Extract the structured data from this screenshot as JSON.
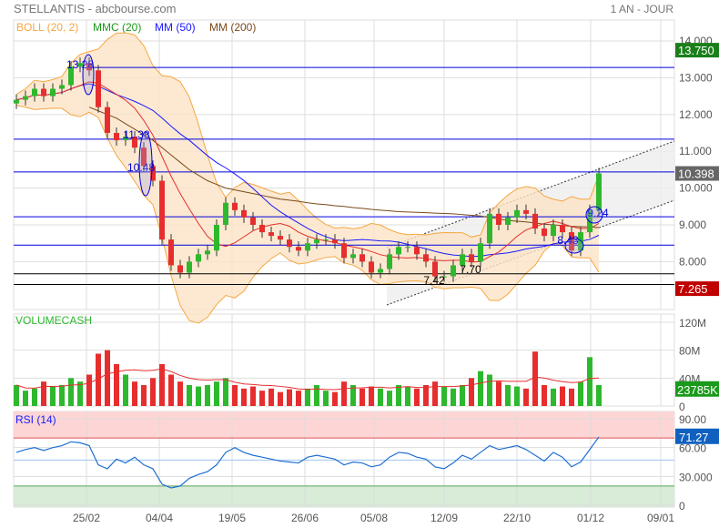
{
  "header": {
    "title": "STELLANTIS - abcbourse.com",
    "period": "1 AN - JOUR"
  },
  "legend": [
    {
      "label": "BOLL (20, 2)",
      "color": "#f5a742"
    },
    {
      "label": "MMC (20)",
      "color": "#1a9a1a"
    },
    {
      "label": "MM (50)",
      "color": "#1a1aff"
    },
    {
      "label": "MM (200)",
      "color": "#7a4a1a"
    }
  ],
  "colors": {
    "up": "#2eb82e",
    "down": "#e62e2e",
    "boll_fill": "#fde3c6",
    "boll_line": "#f5a742",
    "mmc": "#1a9a1a",
    "mm50": "#1a1aff",
    "mm200": "#7a4a1a",
    "level": "#0000dd",
    "rsi": "#1f6fd1"
  },
  "chart_data": [
    {
      "type": "candlestick",
      "title": "STELLANTIS",
      "ylim": [
        7,
        14.4
      ],
      "yticks": [
        "14.000",
        "13.000",
        "12.000",
        "11.000",
        "10.000",
        "9.000",
        "8.000"
      ],
      "ytick_values": [
        14,
        13,
        12,
        11,
        10,
        9,
        8
      ],
      "xticks": [
        "25/02",
        "04/04",
        "19/05",
        "26/06",
        "05/08",
        "12/09",
        "22/10",
        "01/12",
        "09/01"
      ],
      "close": [
        12.4,
        12.5,
        12.7,
        12.5,
        12.7,
        12.8,
        13.3,
        13.4,
        13.2,
        12.2,
        11.5,
        11.3,
        11.4,
        11.1,
        10.6,
        10.2,
        8.6,
        7.9,
        7.7,
        8.0,
        8.2,
        8.3,
        9.0,
        9.6,
        9.4,
        9.2,
        9.0,
        8.8,
        8.7,
        8.6,
        8.4,
        8.3,
        8.5,
        8.6,
        8.6,
        8.5,
        8.1,
        8.2,
        8.0,
        7.7,
        7.8,
        8.2,
        8.4,
        8.4,
        8.2,
        8.0,
        7.6,
        7.6,
        7.9,
        8.2,
        8.0,
        8.5,
        9.3,
        9.0,
        9.2,
        9.4,
        9.3,
        8.9,
        8.7,
        9.0,
        8.8,
        8.3,
        8.8,
        9.4,
        10.4
      ],
      "mm200": [
        null,
        null,
        null,
        null,
        null,
        null,
        null,
        null,
        12.2,
        12.1,
        12.0,
        11.9,
        11.75,
        11.6,
        11.45,
        11.3,
        11.1,
        10.9,
        10.7,
        10.5,
        10.35,
        10.2,
        10.1,
        10.0,
        9.95,
        9.9,
        9.85,
        9.8,
        9.75,
        9.7,
        9.67,
        9.64,
        9.6,
        9.57,
        9.55,
        9.52,
        9.5,
        9.47,
        9.45,
        9.42,
        9.4,
        9.38,
        9.36,
        9.35,
        9.34,
        9.33,
        9.32,
        9.31,
        9.3,
        9.28,
        9.26,
        9.24,
        9.2,
        9.16,
        9.12,
        9.1,
        9.08,
        9.05,
        9.02,
        9.0,
        8.98,
        8.96,
        8.95,
        8.94,
        8.93
      ],
      "levels": [
        {
          "value": 13.28,
          "label": "13.28"
        },
        {
          "value": 11.33,
          "label": "11.38"
        },
        {
          "value": 10.44,
          "label": "10.48"
        },
        {
          "value": 9.22,
          "label": "9.24"
        },
        {
          "value": 8.45,
          "label": "8.43"
        },
        {
          "value": 7.67,
          "label": "7.70",
          "black": true
        },
        {
          "value": 7.38,
          "label": "7.42",
          "black": true
        }
      ],
      "badges": [
        {
          "value": 13.75,
          "label": "13.750",
          "color": "#1a7f1a"
        },
        {
          "value": 10.398,
          "label": "10.398",
          "color": "#666666"
        },
        {
          "value": 7.265,
          "label": "7.265",
          "color": "#c00000"
        }
      ]
    },
    {
      "type": "bar",
      "title": "VOLUMECASH",
      "ylim": [
        0,
        120
      ],
      "yticks": [
        "120M",
        "80M",
        "40M",
        "0"
      ],
      "ytick_values": [
        120,
        80,
        40,
        0
      ],
      "values": [
        30,
        22,
        25,
        35,
        28,
        30,
        40,
        35,
        45,
        75,
        80,
        60,
        45,
        35,
        30,
        40,
        60,
        45,
        35,
        30,
        28,
        30,
        35,
        40,
        30,
        25,
        28,
        22,
        25,
        20,
        24,
        22,
        25,
        30,
        22,
        20,
        35,
        30,
        25,
        28,
        25,
        22,
        30,
        28,
        25,
        30,
        35,
        28,
        25,
        30,
        40,
        50,
        45,
        35,
        30,
        28,
        25,
        78,
        30,
        25,
        28,
        25,
        35,
        70,
        30
      ],
      "current": {
        "label": "23785K",
        "value": 23.8
      }
    },
    {
      "type": "line",
      "title": "RSI (14)",
      "ylim": [
        0,
        90
      ],
      "yticks": [
        "90.00",
        "60.00",
        "30.000",
        "0"
      ],
      "ytick_values": [
        90,
        60,
        30,
        0
      ],
      "values": [
        55,
        58,
        60,
        57,
        60,
        62,
        66,
        65,
        62,
        42,
        38,
        48,
        44,
        50,
        42,
        38,
        22,
        18,
        20,
        28,
        32,
        35,
        42,
        55,
        60,
        55,
        52,
        50,
        48,
        46,
        45,
        44,
        50,
        52,
        50,
        48,
        42,
        45,
        44,
        40,
        42,
        50,
        55,
        54,
        50,
        48,
        40,
        38,
        44,
        52,
        48,
        55,
        62,
        58,
        60,
        62,
        58,
        52,
        46,
        55,
        50,
        40,
        45,
        58,
        71
      ],
      "current": {
        "label": "71.27",
        "value": 71.27
      }
    }
  ]
}
